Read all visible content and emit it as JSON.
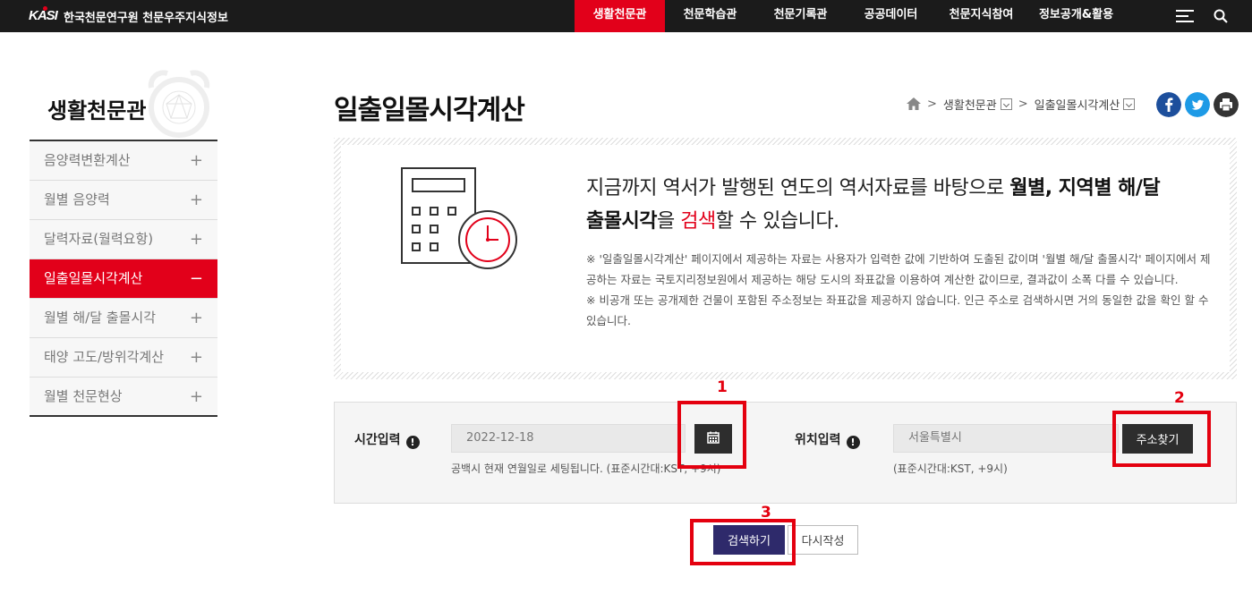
{
  "header": {
    "logo_text": "KASI",
    "site_name": "한국천문연구원 천문우주지식정보",
    "nav": [
      {
        "label": "생활천문관",
        "active": true
      },
      {
        "label": "천문학습관",
        "active": false
      },
      {
        "label": "천문기록관",
        "active": false
      },
      {
        "label": "공공데이터",
        "active": false
      },
      {
        "label": "천문지식참여",
        "active": false
      },
      {
        "label": "정보공개&활용",
        "active": false
      }
    ]
  },
  "sidebar": {
    "title": "생활천문관",
    "items": [
      {
        "label": "음양력변환계산",
        "toggle": "+"
      },
      {
        "label": "월별 음양력",
        "toggle": "+"
      },
      {
        "label": "달력자료(월력요항)",
        "toggle": "+"
      },
      {
        "label": "일출일몰시각계산",
        "toggle": "−"
      },
      {
        "label": "월별 해/달 출몰시각",
        "toggle": "+"
      },
      {
        "label": "태양 고도/방위각계산",
        "toggle": "+"
      },
      {
        "label": "월별 천문현상",
        "toggle": "+"
      }
    ]
  },
  "main": {
    "title": "일출일몰시각계산",
    "breadcrumb": [
      "생활천문관",
      "일출일몰시각계산"
    ],
    "info": {
      "lead_1": "지금까지 역서가 발행된 연도의 역서자료를 바탕으로 ",
      "lead_bold_1": "월별, 지역별 해/달",
      "lead_bold_2": "출몰시각",
      "lead_2": "을 ",
      "lead_red": "검색",
      "lead_3": "할 수 있습니다.",
      "note_1": "※ '일출일몰시각계산' 페이지에서 제공하는 자료는 사용자가 입력한 값에 기반하여 도출된 값이며 '월별 해/달 출몰시각' 페이지에서 제공하는 자료는 국토지리정보원에서 제공하는 해당 도시의 좌표값을 이용하여 계산한 값이므로, 결과값이 소폭 다를 수 있습니다.",
      "note_2": "※ 비공개 또는 공개제한 건물이 포함된 주소정보는 좌표값을 제공하지 않습니다. 인근 주소로 검색하시면 거의 동일한 값을 확인 할 수 있습니다."
    },
    "form": {
      "time_label": "시간입력",
      "time_value": "2022-12-18",
      "time_hint": "공백시 현재 연월일로 세팅됩니다. (표준시간대:KST, +9시)",
      "location_label": "위치입력",
      "location_placeholder": "서울특별시",
      "location_hint": "(표준시간대:KST, +9시)",
      "address_button": "주소찾기",
      "info_icon_glyph": "!"
    },
    "actions": {
      "search": "검색하기",
      "reset": "다시작성"
    }
  },
  "annotations": {
    "marker_1": "1",
    "marker_2": "2",
    "marker_3": "3",
    "color": "#e4000f"
  }
}
